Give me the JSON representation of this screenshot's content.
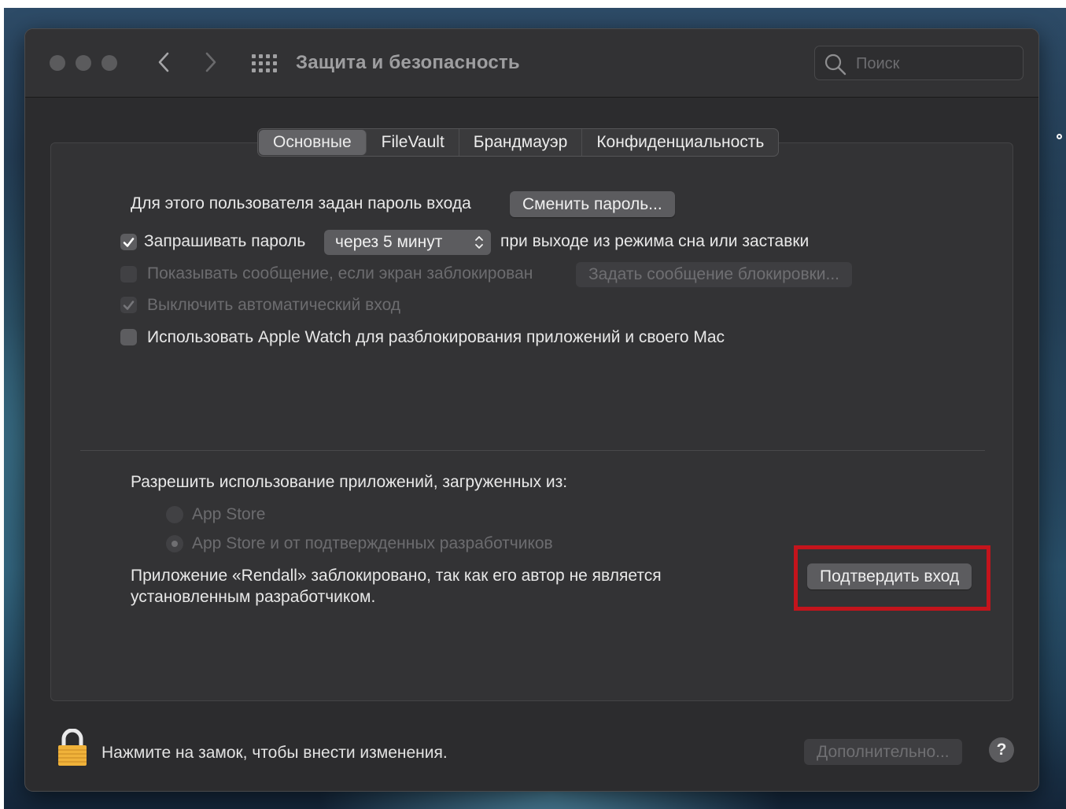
{
  "window": {
    "title": "Защита и безопасность",
    "search_placeholder": "Поиск"
  },
  "tabs": [
    {
      "label": "Основные",
      "active": true
    },
    {
      "label": "FileVault",
      "active": false
    },
    {
      "label": "Брандмауэр",
      "active": false
    },
    {
      "label": "Конфиденциальность",
      "active": false
    }
  ],
  "general": {
    "password_set_label": "Для этого пользователя задан пароль входа",
    "change_password_button": "Сменить пароль...",
    "require_password": {
      "checked": true,
      "label": "Запрашивать пароль",
      "interval_value": "через 5 минут",
      "suffix": "при выходе из режима сна или заставки"
    },
    "show_message": {
      "checked": false,
      "enabled": false,
      "label": "Показывать сообщение, если экран заблокирован",
      "button": "Задать сообщение блокировки..."
    },
    "disable_auto_login": {
      "checked": true,
      "enabled": false,
      "label": "Выключить автоматический вход"
    },
    "apple_watch": {
      "checked": false,
      "label": "Использовать Apple Watch для разблокирования приложений и своего Mac"
    }
  },
  "apps_section": {
    "heading": "Разрешить использование приложений, загруженных из:",
    "options": [
      {
        "label": "App Store",
        "selected": false
      },
      {
        "label": "App Store и от подтвержденных разработчиков",
        "selected": true
      }
    ],
    "blocked_message_line1": "Приложение «Rendall» заблокировано, так как его автор не является",
    "blocked_message_line2": "установленным разработчиком.",
    "open_anyway_button": "Подтвердить вход"
  },
  "footer": {
    "lock_message": "Нажмите на замок, чтобы внести изменения.",
    "advanced_button": "Дополнительно...",
    "help_label": "?"
  },
  "colors": {
    "highlight": "#c4141c",
    "lock_body": "#f0b23a"
  }
}
